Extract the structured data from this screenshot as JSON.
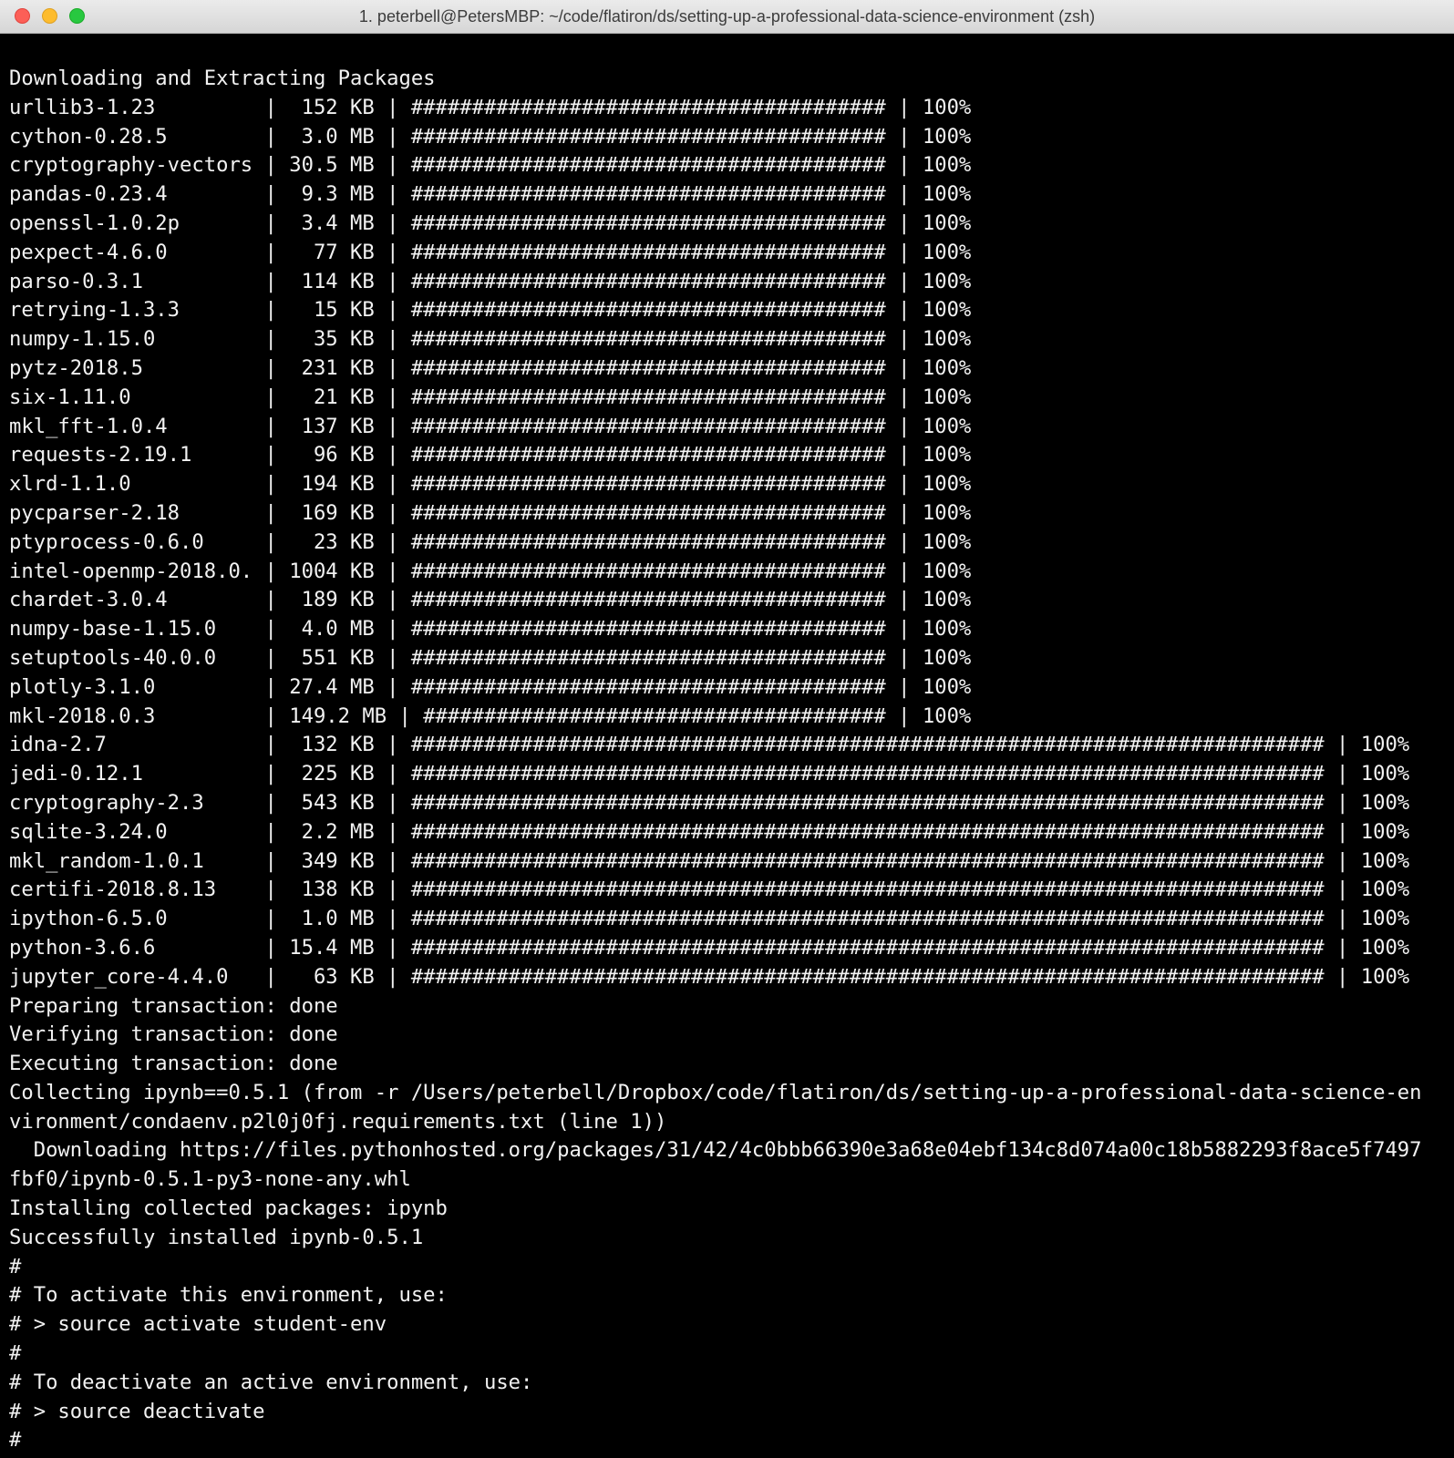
{
  "window": {
    "title": "1. peterbell@PetersMBP: ~/code/flatiron/ds/setting-up-a-professional-data-science-environment (zsh)",
    "colors": {
      "background": "#000000",
      "text": "#f2f2f2",
      "close": "#fc5f57",
      "minimize": "#fdbc2e",
      "zoom": "#28c840"
    }
  },
  "terminal": {
    "lines": [
      "Downloading and Extracting Packages",
      "urllib3-1.23         |  152 KB | ####################################### | 100% ",
      "cython-0.28.5        |  3.0 MB | ####################################### | 100% ",
      "cryptography-vectors | 30.5 MB | ####################################### | 100% ",
      "pandas-0.23.4        |  9.3 MB | ####################################### | 100% ",
      "openssl-1.0.2p       |  3.4 MB | ####################################### | 100% ",
      "pexpect-4.6.0        |   77 KB | ####################################### | 100% ",
      "parso-0.3.1          |  114 KB | ####################################### | 100% ",
      "retrying-1.3.3       |   15 KB | ####################################### | 100% ",
      "numpy-1.15.0         |   35 KB | ####################################### | 100% ",
      "pytz-2018.5          |  231 KB | ####################################### | 100% ",
      "six-1.11.0           |   21 KB | ####################################### | 100% ",
      "mkl_fft-1.0.4        |  137 KB | ####################################### | 100% ",
      "requests-2.19.1      |   96 KB | ####################################### | 100% ",
      "xlrd-1.1.0           |  194 KB | ####################################### | 100% ",
      "pycparser-2.18       |  169 KB | ####################################### | 100% ",
      "ptyprocess-0.6.0     |   23 KB | ####################################### | 100% ",
      "intel-openmp-2018.0. | 1004 KB | ####################################### | 100% ",
      "chardet-3.0.4        |  189 KB | ####################################### | 100% ",
      "numpy-base-1.15.0    |  4.0 MB | ####################################### | 100% ",
      "setuptools-40.0.0    |  551 KB | ####################################### | 100% ",
      "plotly-3.1.0         | 27.4 MB | ####################################### | 100% ",
      "mkl-2018.0.3         | 149.2 MB | ###################################### | 100% ",
      "idna-2.7             |  132 KB | ########################################################################### | 100% ",
      "jedi-0.12.1          |  225 KB | ########################################################################### | 100% ",
      "cryptography-2.3     |  543 KB | ########################################################################### | 100% ",
      "sqlite-3.24.0        |  2.2 MB | ########################################################################### | 100% ",
      "mkl_random-1.0.1     |  349 KB | ########################################################################### | 100% ",
      "certifi-2018.8.13    |  138 KB | ########################################################################### | 100% ",
      "ipython-6.5.0        |  1.0 MB | ########################################################################### | 100% ",
      "python-3.6.6         | 15.4 MB | ########################################################################### | 100% ",
      "jupyter_core-4.4.0   |   63 KB | ########################################################################### | 100% ",
      "Preparing transaction: done",
      "Verifying transaction: done",
      "Executing transaction: done",
      "Collecting ipynb==0.5.1 (from -r /Users/peterbell/Dropbox/code/flatiron/ds/setting-up-a-professional-data-science-en",
      "vironment/condaenv.p2l0j0fj.requirements.txt (line 1))",
      "  Downloading https://files.pythonhosted.org/packages/31/42/4c0bbb66390e3a68e04ebf134c8d074a00c18b5882293f8ace5f7497",
      "fbf0/ipynb-0.5.1-py3-none-any.whl",
      "Installing collected packages: ipynb",
      "Successfully installed ipynb-0.5.1",
      "#",
      "# To activate this environment, use:",
      "# > source activate student-env",
      "#",
      "# To deactivate an active environment, use:",
      "# > source deactivate",
      "#"
    ]
  }
}
